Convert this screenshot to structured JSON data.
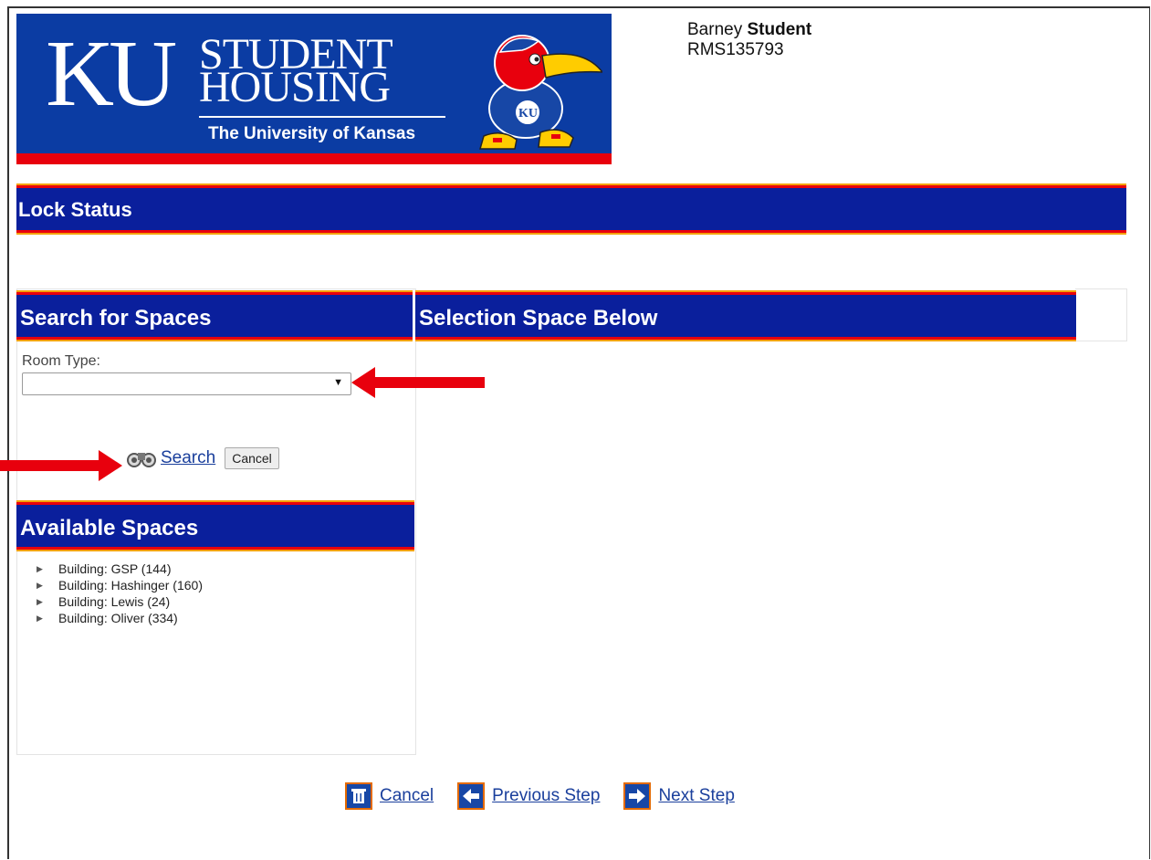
{
  "header": {
    "logo_ku": "KU",
    "logo_line1": "STUDENT",
    "logo_line2": "HOUSING",
    "logo_university": "The University of Kansas"
  },
  "user": {
    "first_name": "Barney",
    "last_name": "Student",
    "id": "RMS135793"
  },
  "page_title": "Lock Status",
  "search_panel": {
    "title": "Search for Spaces",
    "room_type_label": "Room Type:",
    "room_type_value": "",
    "search_label": "Search",
    "cancel_label": "Cancel"
  },
  "selection_panel": {
    "title": "Selection Space Below"
  },
  "available_spaces": {
    "title": "Available Spaces",
    "items": [
      {
        "label": "Building: GSP (144)"
      },
      {
        "label": "Building: Hashinger (160)"
      },
      {
        "label": "Building: Lewis (24)"
      },
      {
        "label": "Building: Oliver (334)"
      }
    ]
  },
  "footer": {
    "cancel_label": "Cancel",
    "previous_label": "Previous Step",
    "next_label": "Next Step"
  },
  "colors": {
    "bar_blue": "#0a1f9c",
    "banner_blue": "#0b3ca3",
    "accent_red": "#e8000d",
    "accent_gold": "#f5a000",
    "link_blue": "#1a3f9c"
  },
  "icons": {
    "search": "binoculars-icon",
    "cancel": "trash-icon",
    "previous": "arrow-left-icon",
    "next": "arrow-right-icon",
    "tree": "triangle-right-icon",
    "annotation": "red-arrow-icon"
  }
}
